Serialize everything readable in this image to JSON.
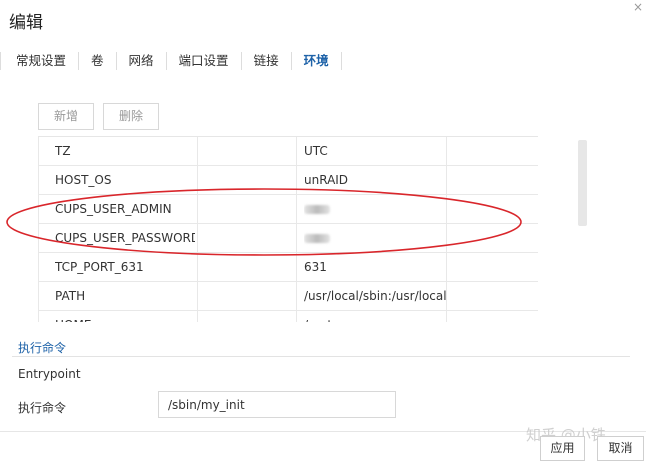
{
  "dialog": {
    "title": "编辑",
    "close_icon": "×"
  },
  "tabs": [
    {
      "label": "常规设置",
      "active": false
    },
    {
      "label": "卷",
      "active": false
    },
    {
      "label": "网络",
      "active": false
    },
    {
      "label": "端口设置",
      "active": false
    },
    {
      "label": "链接",
      "active": false
    },
    {
      "label": "环境",
      "active": true
    }
  ],
  "toolbar": {
    "add_label": "新增",
    "delete_label": "删除"
  },
  "env_table": {
    "rows": [
      {
        "name": "TZ",
        "value": "UTC",
        "redacted": false
      },
      {
        "name": "HOST_OS",
        "value": "unRAID",
        "redacted": false
      },
      {
        "name": "CUPS_USER_ADMIN",
        "value": "",
        "redacted": true
      },
      {
        "name": "CUPS_USER_PASSWORD",
        "value": "",
        "redacted": true
      },
      {
        "name": "TCP_PORT_631",
        "value": "631",
        "redacted": false
      },
      {
        "name": "PATH",
        "value": "/usr/local/sbin:/usr/local",
        "redacted": false
      },
      {
        "name": "HOME",
        "value": "/root",
        "redacted": false
      }
    ]
  },
  "exec": {
    "section_title": "执行命令",
    "entrypoint_label": "Entrypoint",
    "command_label": "执行命令",
    "command_value": "/sbin/my_init"
  },
  "footer": {
    "apply_label": "应用",
    "cancel_label": "取消"
  },
  "watermark": "知乎 @小铁",
  "colors": {
    "accent": "#1e62a8",
    "annotation": "#d9262b"
  }
}
